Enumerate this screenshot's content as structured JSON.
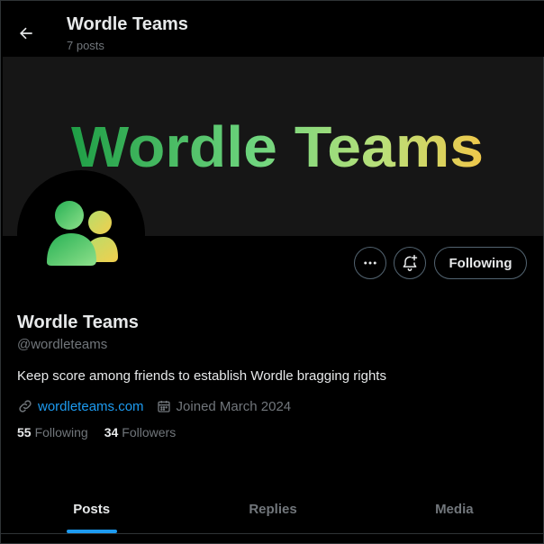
{
  "header": {
    "title": "Wordle Teams",
    "subtitle": "7 posts"
  },
  "banner": {
    "text": "Wordle Teams"
  },
  "actions": {
    "following_label": "Following"
  },
  "profile": {
    "display_name": "Wordle Teams",
    "handle": "@wordleteams",
    "bio": "Keep score among friends to establish Wordle bragging rights",
    "website": "wordleteams.com",
    "joined": "Joined March 2024",
    "following_count": "55",
    "following_label": "Following",
    "followers_count": "34",
    "followers_label": "Followers"
  },
  "tabs": [
    {
      "label": "Posts",
      "active": true
    },
    {
      "label": "Replies",
      "active": false
    },
    {
      "label": "Media",
      "active": false
    }
  ],
  "colors": {
    "accent": "#1d9bf0",
    "background": "#000000",
    "banner": "#161616",
    "gradient_start": "#1f9e46",
    "gradient_mid": "#7fd87a",
    "gradient_end": "#f0c84a"
  }
}
